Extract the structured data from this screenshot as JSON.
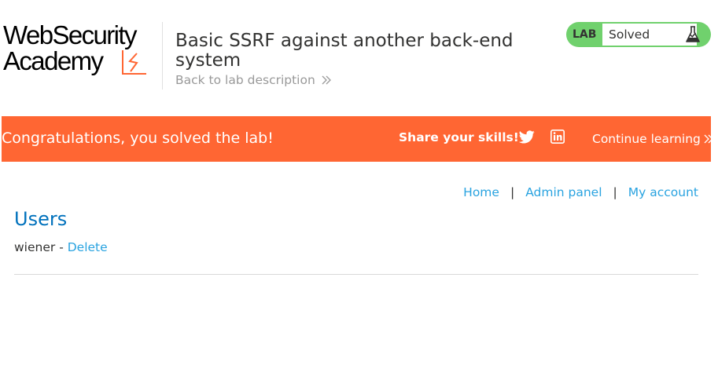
{
  "header": {
    "logo": {
      "line1": "WebSecurity",
      "line2": "Academy"
    },
    "lab_title": "Basic SSRF against another back-end system",
    "back_link": "Back to lab description"
  },
  "status": {
    "tag": "LAB",
    "value": "Solved"
  },
  "banner": {
    "message": "Congratulations, you solved the lab!",
    "share_label": "Share your skills!",
    "continue_label": "Continue learning"
  },
  "nav": {
    "home": "Home",
    "admin_panel": "Admin panel",
    "my_account": "My account",
    "separator": "|"
  },
  "main": {
    "heading": "Users",
    "users": [
      {
        "name": "wiener",
        "separator": " - ",
        "action": "Delete"
      }
    ]
  },
  "colors": {
    "accent_orange": "#ff6633",
    "solved_green": "#70d16d",
    "link_blue": "#29a3e0",
    "heading_blue": "#0071bc"
  }
}
